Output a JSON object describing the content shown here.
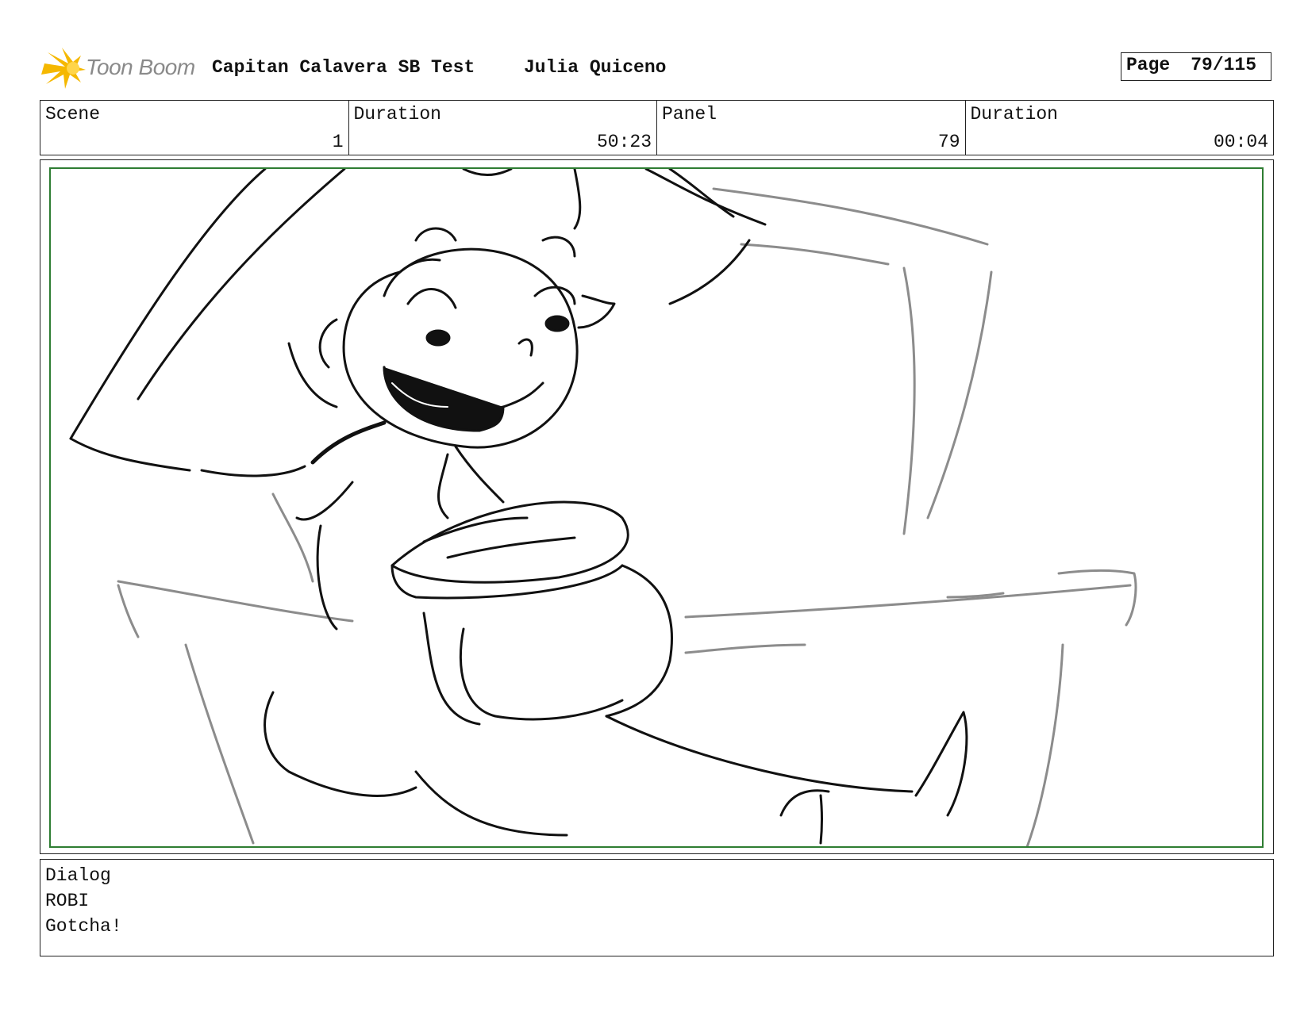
{
  "header": {
    "logo_text": "Toon Boom",
    "project_title": "Capitan Calavera SB Test",
    "author": "Julia Quiceno",
    "page_label": "Page",
    "page_value": "79/115"
  },
  "info": {
    "scene_label": "Scene",
    "scene_value": "1",
    "scene_duration_label": "Duration",
    "scene_duration_value": "50:23",
    "panel_label": "Panel",
    "panel_value": "79",
    "panel_duration_label": "Duration",
    "panel_duration_value": "00:04"
  },
  "dialog": {
    "label": "Dialog",
    "speaker": "ROBI",
    "line": "Gotcha!"
  },
  "colors": {
    "safe_frame": "#2e7d32",
    "logo_accent": "#f5b800",
    "sketch_dark": "#111111",
    "sketch_light": "#8c8c8c"
  },
  "icons": {
    "logo": "toon-boom-star-burst-icon"
  }
}
